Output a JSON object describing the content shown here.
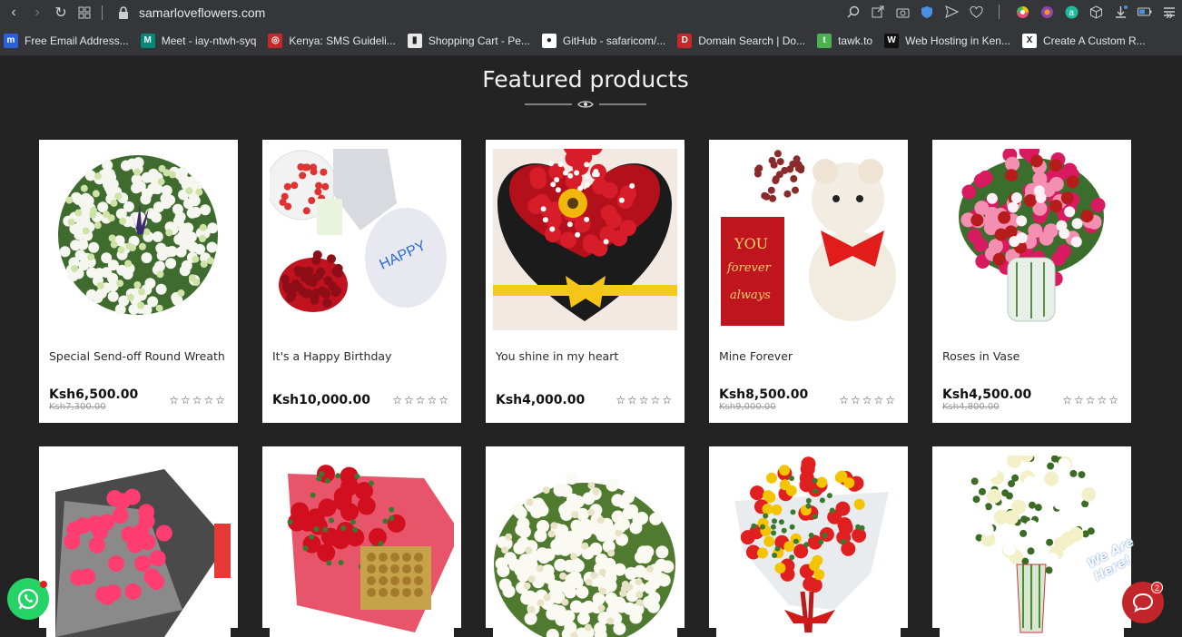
{
  "browser": {
    "url": "samarloveflowers.com",
    "bookmarks": [
      {
        "label": "Free Email Address...",
        "color": "#2b5fd9",
        "glyph": "m"
      },
      {
        "label": "Meet - iay-ntwh-syq",
        "color": "#00897b",
        "glyph": "M"
      },
      {
        "label": "Kenya: SMS Guideli...",
        "color": "#c62828",
        "glyph": "◎"
      },
      {
        "label": "Shopping Cart - Pe...",
        "color": "#e8e8e8",
        "glyph": "▮"
      },
      {
        "label": "GitHub - safaricom/...",
        "color": "#ffffff",
        "glyph": "●"
      },
      {
        "label": "Domain Search | Do...",
        "color": "#c62828",
        "glyph": "D"
      },
      {
        "label": "tawk.to",
        "color": "#4caf50",
        "glyph": "t"
      },
      {
        "label": "Web Hosting in Ken...",
        "color": "#111111",
        "glyph": "W"
      },
      {
        "label": "Create A Custom R...",
        "color": "#ffffff",
        "glyph": "X"
      }
    ]
  },
  "section": {
    "title": "Featured products"
  },
  "products": [
    {
      "name": "Special Send-off Round Wreath",
      "price": "Ksh6,500.00",
      "old_price": "Ksh7,300.00",
      "image": "wreath-white"
    },
    {
      "name": "It's a Happy Birthday",
      "price": "Ksh10,000.00",
      "old_price": "",
      "image": "birthday"
    },
    {
      "name": "You shine in my heart",
      "price": "Ksh4,000.00",
      "old_price": "",
      "image": "heart-box"
    },
    {
      "name": "Mine Forever",
      "price": "Ksh8,500.00",
      "old_price": "Ksh9,000.00",
      "image": "teddy"
    },
    {
      "name": "Roses in Vase",
      "price": "Ksh4,500.00",
      "old_price": "Ksh4,800.00",
      "image": "roses-vase"
    },
    {
      "name": "",
      "price": "",
      "old_price": "",
      "image": "pink-bouquet"
    },
    {
      "name": "",
      "price": "",
      "old_price": "",
      "image": "red-ferrero"
    },
    {
      "name": "",
      "price": "",
      "old_price": "",
      "image": "white-basket"
    },
    {
      "name": "",
      "price": "",
      "old_price": "",
      "image": "mixed-bouquet"
    },
    {
      "name": "",
      "price": "",
      "old_price": "",
      "image": "lilies-vase"
    }
  ],
  "stars": "☆☆☆☆☆",
  "widgets": {
    "we_are_here": "We Are Here!",
    "chat_badge": "2"
  }
}
